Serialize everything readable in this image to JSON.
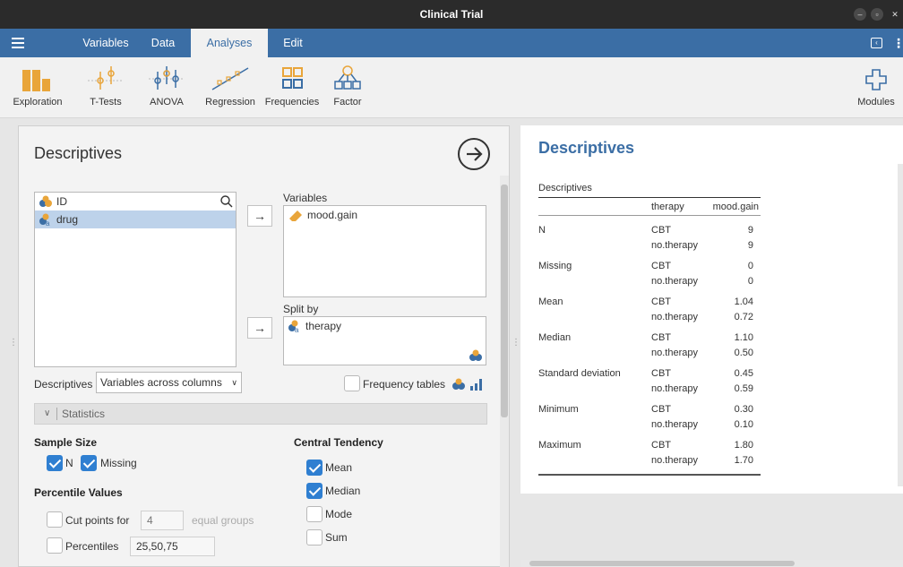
{
  "window": {
    "title": "Clinical Trial"
  },
  "menu": {
    "tabs": [
      {
        "label": "Variables"
      },
      {
        "label": "Data"
      },
      {
        "label": "Analyses"
      },
      {
        "label": "Edit"
      }
    ],
    "active_tab": "Analyses"
  },
  "ribbon": {
    "items": [
      {
        "label": "Exploration",
        "icon": "exploration-icon"
      },
      {
        "label": "T-Tests",
        "icon": "t-tests-icon"
      },
      {
        "label": "ANOVA",
        "icon": "anova-icon"
      },
      {
        "label": "Regression",
        "icon": "regression-icon"
      },
      {
        "label": "Frequencies",
        "icon": "frequencies-icon"
      },
      {
        "label": "Factor",
        "icon": "factor-icon"
      }
    ],
    "modules_label": "Modules"
  },
  "options": {
    "title": "Descriptives",
    "available_vars": [
      {
        "name": "ID",
        "icon": "nominal-integer-icon"
      },
      {
        "name": "drug",
        "icon": "nominal-text-icon"
      }
    ],
    "variables_label": "Variables",
    "variables": [
      {
        "name": "mood.gain",
        "icon": "continuous-ruler-icon"
      }
    ],
    "split_by_label": "Split by",
    "split_by": [
      {
        "name": "therapy",
        "icon": "nominal-text-icon"
      }
    ],
    "descriptives_label": "Descriptives",
    "descriptives_value": "Variables across columns",
    "frequency_tables_label": "Frequency tables",
    "statistics_label": "Statistics",
    "sample_size": {
      "heading": "Sample Size",
      "n_label": "N",
      "n_checked": true,
      "missing_label": "Missing",
      "missing_checked": true
    },
    "percentile_values": {
      "heading": "Percentile Values",
      "cut_points_label": "Cut points for",
      "cut_points_value": "4",
      "equal_groups_label": "equal groups",
      "percentiles_label": "Percentiles",
      "percentiles_value": "25,50,75"
    },
    "central_tendency": {
      "heading": "Central Tendency",
      "items": [
        {
          "label": "Mean",
          "checked": true
        },
        {
          "label": "Median",
          "checked": true
        },
        {
          "label": "Mode",
          "checked": false
        },
        {
          "label": "Sum",
          "checked": false
        }
      ]
    }
  },
  "results": {
    "title": "Descriptives",
    "table_title": "Descriptives",
    "columns": [
      "",
      "therapy",
      "mood.gain"
    ],
    "rows": [
      {
        "stat": "N",
        "groups": [
          "CBT",
          "no.therapy"
        ],
        "values": [
          "9",
          "9"
        ]
      },
      {
        "stat": "Missing",
        "groups": [
          "CBT",
          "no.therapy"
        ],
        "values": [
          "0",
          "0"
        ]
      },
      {
        "stat": "Mean",
        "groups": [
          "CBT",
          "no.therapy"
        ],
        "values": [
          "1.04",
          "0.72"
        ]
      },
      {
        "stat": "Median",
        "groups": [
          "CBT",
          "no.therapy"
        ],
        "values": [
          "1.10",
          "0.50"
        ]
      },
      {
        "stat": "Standard deviation",
        "groups": [
          "CBT",
          "no.therapy"
        ],
        "values": [
          "0.45",
          "0.59"
        ]
      },
      {
        "stat": "Minimum",
        "groups": [
          "CBT",
          "no.therapy"
        ],
        "values": [
          "0.30",
          "0.10"
        ]
      },
      {
        "stat": "Maximum",
        "groups": [
          "CBT",
          "no.therapy"
        ],
        "values": [
          "1.80",
          "1.70"
        ]
      }
    ]
  },
  "colors": {
    "accent": "#3b6ea5",
    "check": "#2f7fd1",
    "selection": "#bdd2ea"
  }
}
